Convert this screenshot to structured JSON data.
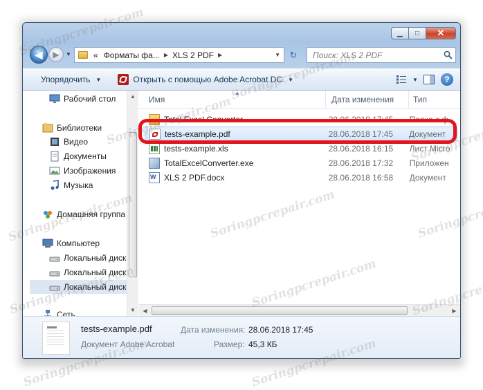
{
  "window": {
    "controls": {
      "minimize": "▁",
      "maximize": "□",
      "close": "✕"
    }
  },
  "navbar": {
    "back_glyph": "◀",
    "forward_glyph": "▶",
    "dropdown_glyph": "▼",
    "breadcrumb_prefix": "«",
    "breadcrumbs": [
      "Форматы фа...",
      "XLS 2 PDF"
    ],
    "breadcrumb_separator": "▶",
    "refresh_glyph": "↻",
    "search_placeholder": "Поиск: XLS 2 PDF"
  },
  "toolbar": {
    "organize_label": "Упорядочить",
    "open_with_label": "Открыть с помощью Adobe Acrobat DC",
    "dropdown_glyph": "▼",
    "help_glyph": "?"
  },
  "sidebar": {
    "items": [
      {
        "label": "Рабочий стол",
        "icon": "desktop-icon"
      },
      {
        "label": "Библиотеки",
        "icon": "libraries-icon"
      },
      {
        "label": "Видео",
        "icon": "video-icon"
      },
      {
        "label": "Документы",
        "icon": "documents-icon"
      },
      {
        "label": "Изображения",
        "icon": "images-icon"
      },
      {
        "label": "Музыка",
        "icon": "music-icon"
      },
      {
        "label": "Домашняя группа",
        "icon": "homegroup-icon"
      },
      {
        "label": "Компьютер",
        "icon": "computer-icon"
      },
      {
        "label": "Локальный диск",
        "icon": "local-disk-icon"
      },
      {
        "label": "Локальный диск",
        "icon": "local-disk-icon"
      },
      {
        "label": "Локальный диск",
        "icon": "local-disk-icon"
      },
      {
        "label": "Сеть",
        "icon": "network-icon"
      }
    ]
  },
  "columns": {
    "name": "Имя",
    "date": "Дата изменения",
    "type": "Тип",
    "sort_glyph": "▲"
  },
  "files": [
    {
      "name": "Total Excel Converter",
      "date": "28.06.2018 17:45",
      "type": "Папка с ф",
      "icon": "folder-icon"
    },
    {
      "name": "tests-example.pdf",
      "date": "28.06.2018 17:45",
      "type": "Документ",
      "icon": "pdf-file-icon"
    },
    {
      "name": "tests-example.xls",
      "date": "28.06.2018 16:15",
      "type": "Лист Micro",
      "icon": "xls-file-icon"
    },
    {
      "name": "TotalExcelConverter.exe",
      "date": "28.06.2018 17:32",
      "type": "Приложен",
      "icon": "exe-file-icon"
    },
    {
      "name": "XLS 2 PDF.docx",
      "date": "28.06.2018 16:58",
      "type": "Документ",
      "icon": "docx-file-icon"
    }
  ],
  "details": {
    "file_name": "tests-example.pdf",
    "file_type": "Документ Adobe Acrobat",
    "modified_label": "Дата изменения:",
    "modified_value": "28.06.2018 17:45",
    "size_label": "Размер:",
    "size_value": "45,3 КБ"
  },
  "watermark": "Soringpcrepair.com",
  "colors": {
    "highlight": "#e4141b",
    "selection": "#d5e7fb",
    "accent": "#1e395b"
  }
}
